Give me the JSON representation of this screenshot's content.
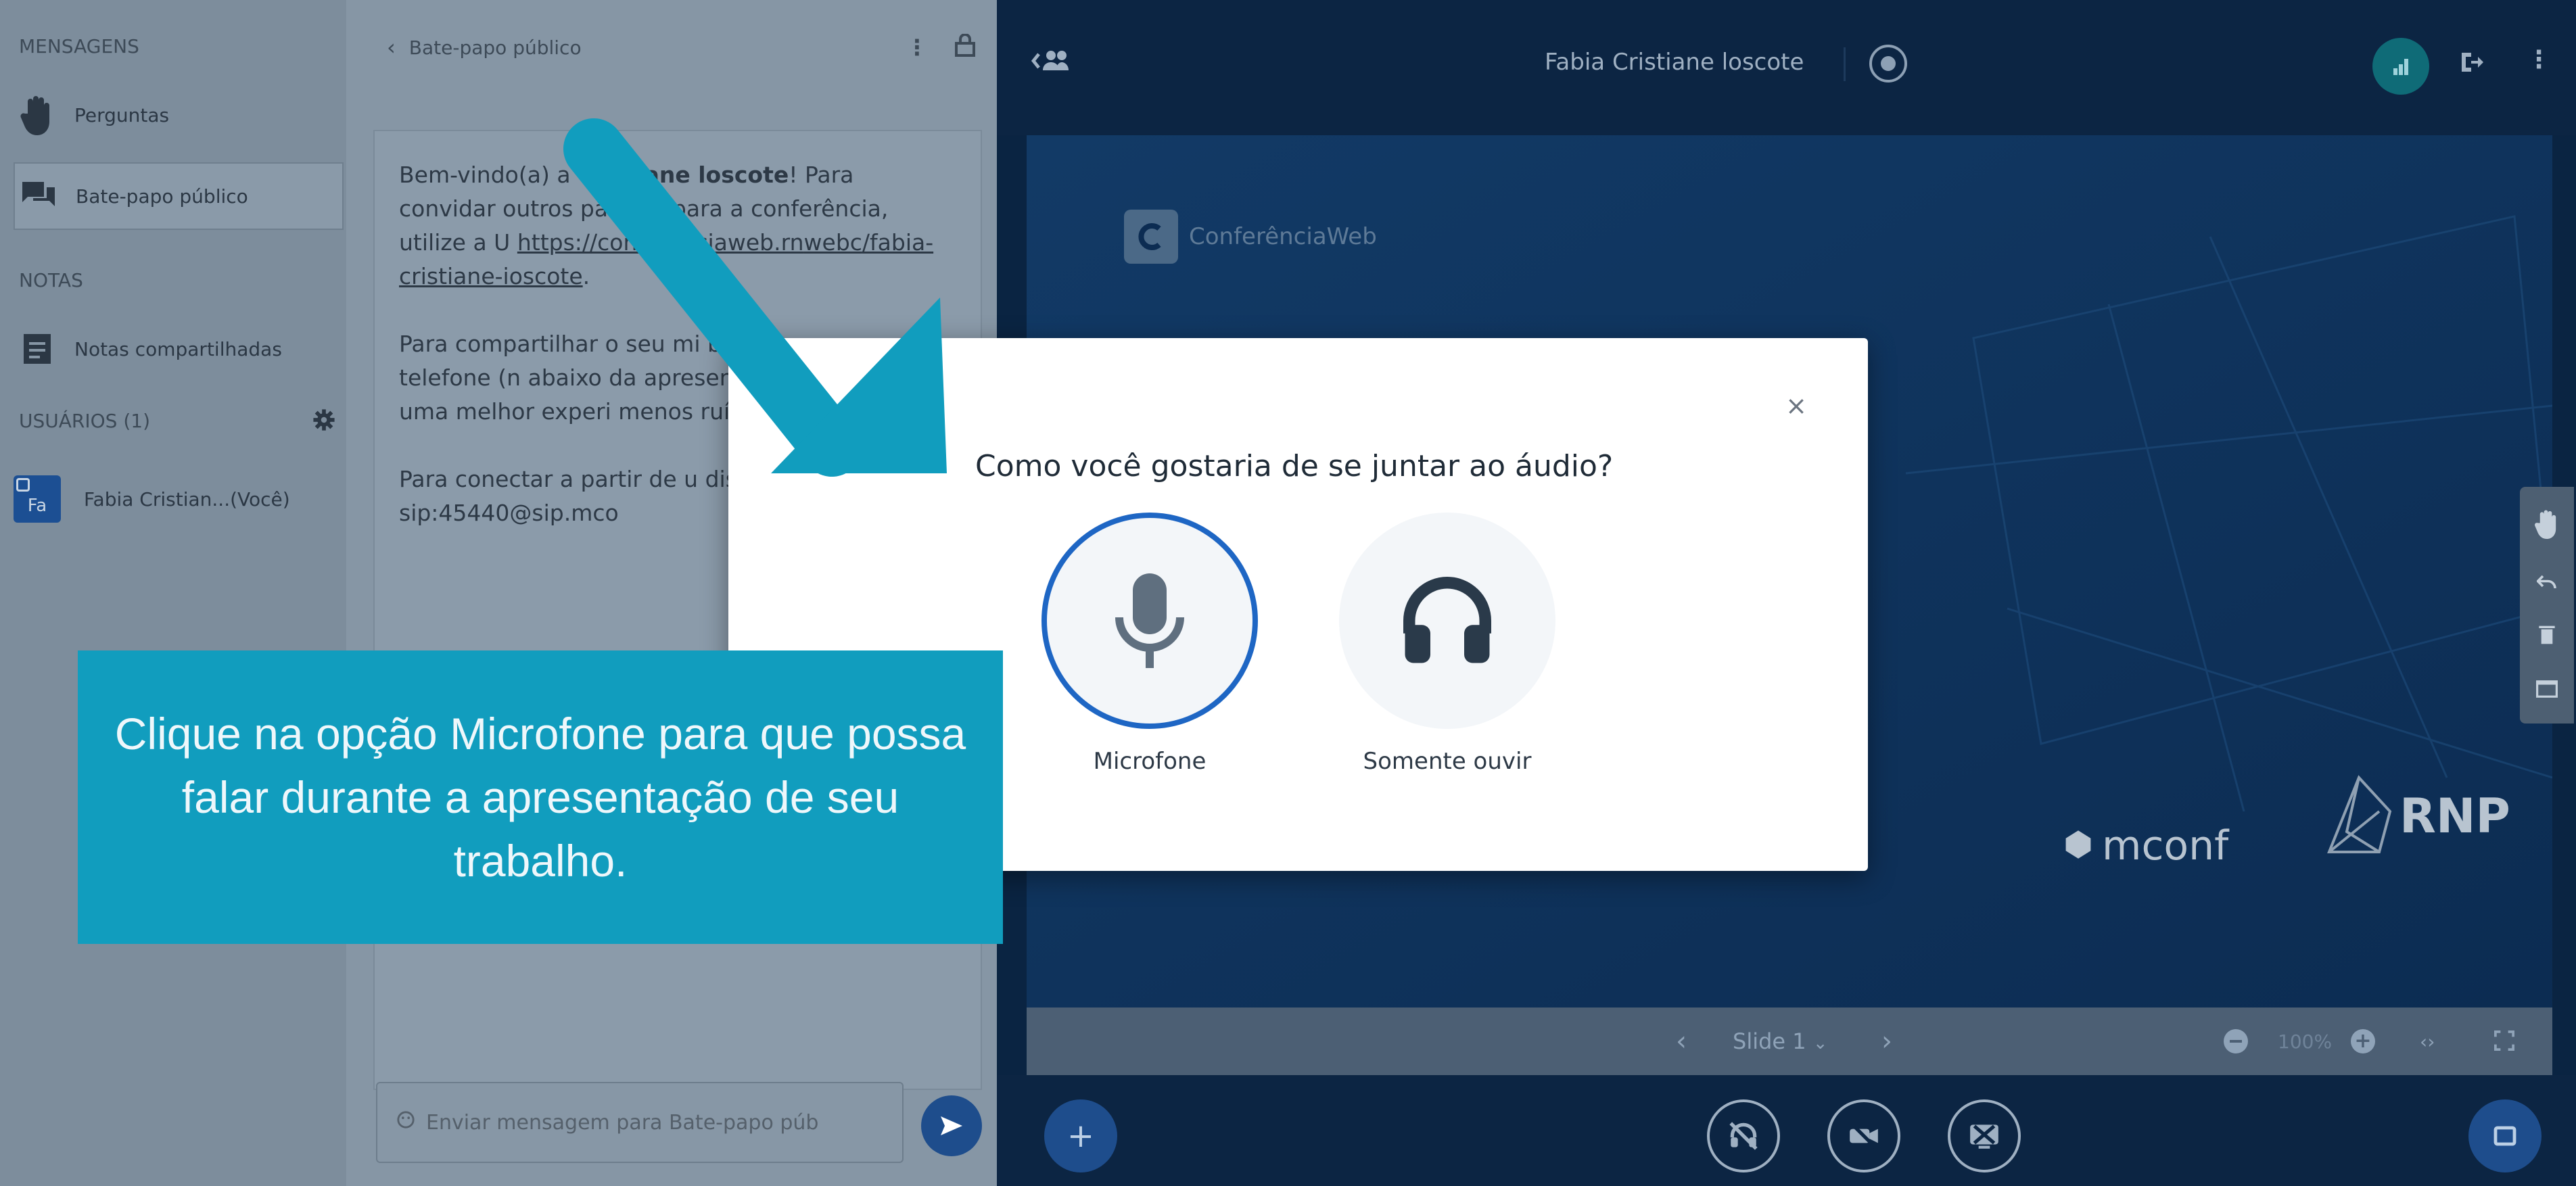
{
  "sidebar": {
    "messages_title": "MENSAGENS",
    "questions_label": "Perguntas",
    "public_chat_label": "Bate-papo público",
    "notes_title": "NOTAS",
    "shared_notes_label": "Notas compartilhadas",
    "users_title": "USUÁRIOS (1)",
    "user_avatar": "Fa",
    "user_name": "Fabia Cristian...(Você)"
  },
  "chat": {
    "header_title": "Bate-papo público",
    "welcome_a": "Bem-vindo(a) a ",
    "welcome_b": "Cristiane loscote",
    "welcome_c": "! Para convidar outros par",
    "welcome_d": "ntes para a conferência, utilize a U",
    "link": "https://conferenciaweb.rn",
    "link_b": "webc",
    "link_c": "/fabia-cristiane-ioscote",
    "p2": "Para compartilhar o seu mi botão com um telefone (n abaixo da apresentação). U para ter uma melhor experi menos ruídos.",
    "p3": "Para conectar a partir de u disque sip:45440@sip.mco",
    "input_placeholder": "Enviar mensagem para Bate-papo púb"
  },
  "topbar": {
    "meeting_title": "Fabia Cristiane loscote"
  },
  "slide": {
    "brand": "ConferênciaWeb",
    "mconf": "mconf",
    "rnp": "RNP",
    "slide_label": "Slide 1",
    "zoom": "100%"
  },
  "modal": {
    "title": "Como você gostaria de se juntar ao áudio?",
    "close": "×",
    "mic_label": "Microfone",
    "listen_label": "Somente ouvir"
  },
  "callout": {
    "text": "Clique na opção Microfone para que possa falar durante a apresentação de seu trabalho."
  },
  "colors": {
    "accent": "#119dbe",
    "mic_ring": "#1e66c4",
    "dark_navy": "#0c2543"
  }
}
